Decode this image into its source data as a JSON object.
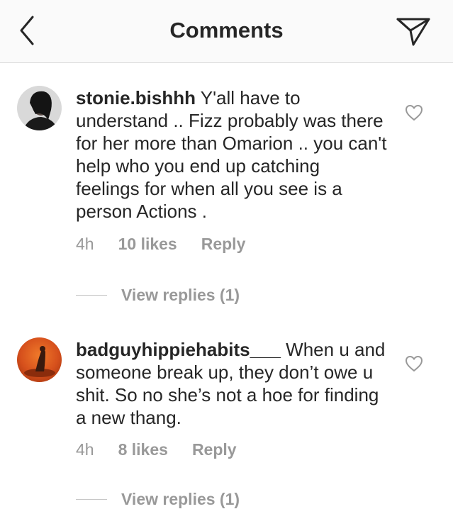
{
  "header": {
    "title": "Comments",
    "back_icon": "chevron-left-icon",
    "send_icon": "direct-send-icon"
  },
  "comments": [
    {
      "username": "stonie.bishhh",
      "text": " Y'all have to understand .. Fizz probably was there for her more than Omarion .. you can't help who you end up catching feelings for when all you see is a person Actions .",
      "time": "4h",
      "likes": "10 likes",
      "reply": "Reply",
      "view_replies": "View replies (1)"
    },
    {
      "username": "badguyhippiehabits___",
      "text": " When u and someone break up, they don’t owe u shit. So no she’s not a hoe for finding a new thang.",
      "time": "4h",
      "likes": "8 likes",
      "reply": "Reply",
      "view_replies": "View replies (1)"
    }
  ],
  "colors": {
    "header_bg": "#fafafa",
    "text": "#262626",
    "muted": "#999999"
  }
}
